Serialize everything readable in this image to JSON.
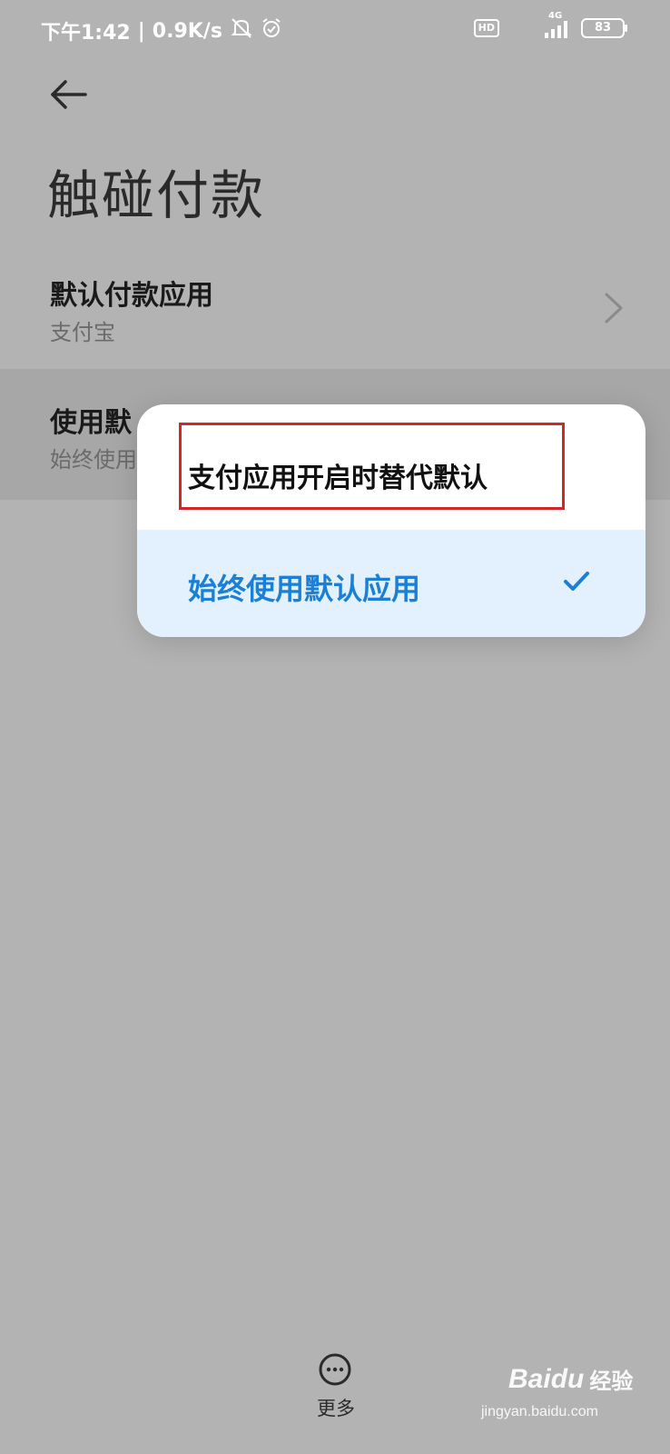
{
  "status_bar": {
    "time": "下午1:42",
    "speed": "0.9K/s",
    "hd": "HD",
    "network": "4G",
    "battery": "83"
  },
  "page": {
    "title": "触碰付款"
  },
  "settings": {
    "default_app": {
      "title": "默认付款应用",
      "value": "支付宝"
    },
    "use_default": {
      "title_partial": "使用默",
      "value_partial": "始终使用"
    }
  },
  "popup": {
    "options": [
      {
        "label": "支付应用开启时替代默认",
        "selected": false
      },
      {
        "label": "始终使用默认应用",
        "selected": true
      }
    ],
    "accent_color": "#1a7fd6",
    "highlight_color": "#d3262a"
  },
  "bottom": {
    "more_label": "更多"
  },
  "watermark": {
    "brand": "Bai",
    "brand2": "du",
    "suffix": "经验",
    "url": "jingyan.baidu.com"
  }
}
